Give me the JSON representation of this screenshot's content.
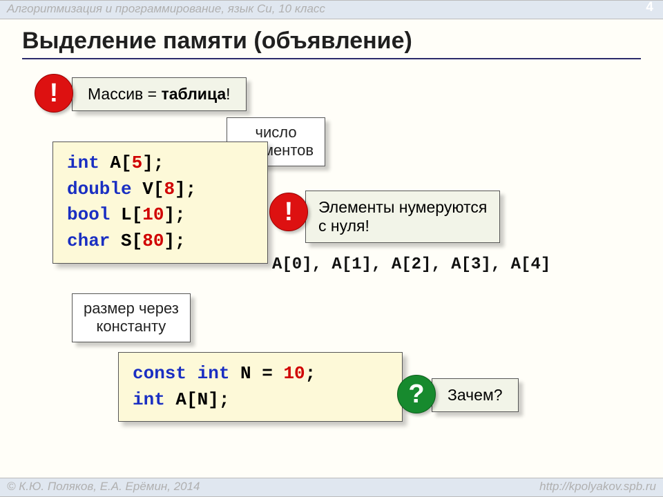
{
  "header": {
    "text": "Алгоритмизация и программирование, язык Си, 10 класс",
    "page": "4"
  },
  "title": "Выделение памяти (объявление)",
  "note1": {
    "pre": "Массив = ",
    "bold": "таблица",
    "post": "!"
  },
  "callout1": "число\nэлементов",
  "code1": {
    "l1": {
      "kw": "int",
      "mid": " A[",
      "num": "5",
      "end": "];"
    },
    "l2": {
      "kw": "double",
      "mid": " V[",
      "num": "8",
      "end": "];"
    },
    "l3": {
      "kw": "bool",
      "mid": " L[",
      "num": "10",
      "end": "];"
    },
    "l4": {
      "kw": "char",
      "mid": " S[",
      "num": "80",
      "end": "];"
    }
  },
  "note2": "Элементы нумеруются\nс нуля!",
  "indices": "A[0], A[1], A[2], A[3], A[4]",
  "callout2": "размер через\nконстанту",
  "code2": {
    "l1": {
      "kw1": "const",
      "sp": " ",
      "kw2": "int",
      "mid": " N = ",
      "num": "10",
      "end": ";"
    },
    "l2": {
      "kw": "int",
      "rest": " A[N];"
    }
  },
  "note3": "Зачем?",
  "badge_excl": "!",
  "badge_q": "?",
  "footer": {
    "left": "© К.Ю. Поляков, Е.А. Ерёмин, 2014",
    "right": "http://kpolyakov.spb.ru"
  }
}
